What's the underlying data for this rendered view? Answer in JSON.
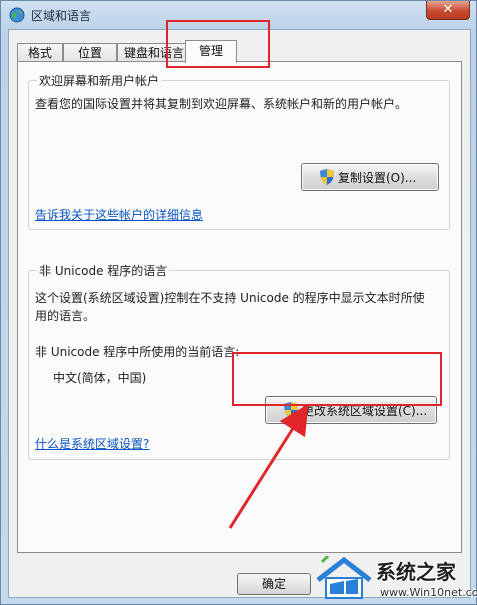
{
  "window": {
    "title": "区域和语言",
    "close_glyph": "✕"
  },
  "tabs": [
    {
      "label": "格式"
    },
    {
      "label": "位置"
    },
    {
      "label": "键盘和语言"
    },
    {
      "label": "管理"
    }
  ],
  "welcome_group": {
    "title": "欢迎屏幕和新用户帐户",
    "description": "查看您的国际设置并将其复制到欢迎屏幕、系统帐户和新的用户帐户。",
    "copy_button": "复制设置(O)...",
    "link": "告诉我关于这些帐户的详细信息"
  },
  "unicode_group": {
    "title": "非 Unicode 程序的语言",
    "description_line1": "这个设置(系统区域设置)控制在不支持 Unicode 的程序中显示文本时所使",
    "description_line2": "用的语言。",
    "current_label": "非 Unicode 程序中所使用的当前语言:",
    "current_value": "中文(简体，中国)",
    "change_button": "更改系统区域设置(C)...",
    "link": "什么是系统区域设置?"
  },
  "footer": {
    "ok_button": "确定"
  },
  "watermark": {
    "brand": "系统之家",
    "site": "www.Win10net.com"
  },
  "colors": {
    "highlight": "#e0262b",
    "link": "#0b53c7",
    "titlebar": "#c6d9ec",
    "close_button": "#c84b30"
  },
  "icons": {
    "title": "globe-icon",
    "button": "uac-shield-icon"
  }
}
